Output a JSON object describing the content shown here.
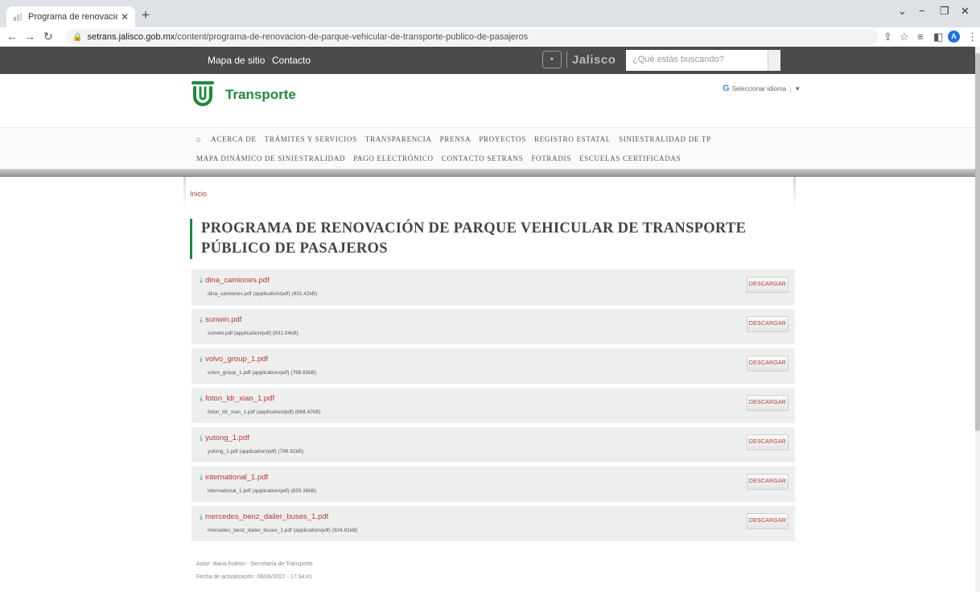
{
  "browser": {
    "tab_title": "Programa de renovación de parq",
    "tab_close": "✕",
    "new_tab": "+",
    "url_host": "setrans.jalisco.gob.mx",
    "url_path": "/content/programa-de-renovacion-de-parque-vehicular-de-transporte-publico-de-pasajeros",
    "profile_initial": "A",
    "nav_icons": [
      "back-icon",
      "forward-icon",
      "reload-icon"
    ]
  },
  "topbar": {
    "links": [
      "Mapa de sitio",
      "Contacto"
    ],
    "logo_text": "Jalisco",
    "search_placeholder": "¿Qué estás buscando?"
  },
  "brand": {
    "name": "Transporte",
    "color": "#1f8a3a",
    "translate_label": "Seleccionar idioma",
    "translate_arrow": "▼"
  },
  "nav": {
    "row1": [
      "ACERCA DE",
      "TRÁMITES Y SERVICIOS",
      "TRANSPARENCIA",
      "PRENSA",
      "PROYECTOS",
      "REGISTRO ESTATAL",
      "SINIESTRALIDAD DE TP"
    ],
    "row2": [
      "MAPA DINÁMICO DE SINIESTRALIDAD",
      "PAGO ELECTRÓNICO",
      "CONTACTO SETRANS",
      "FOTRADIS",
      "ESCUELAS CERTIFICADAS"
    ]
  },
  "breadcrumb": "Inicio",
  "page_title": "PROGRAMA DE RENOVACIÓN DE PARQUE VEHICULAR DE TRANSPORTE PÚBLICO DE PASAJEROS",
  "download_label": "DESCARGAR",
  "files": [
    {
      "name": "dina_camiones.pdf",
      "meta": "dina_camiones.pdf (application/pdf) (831.42kB)"
    },
    {
      "name": "sunwin.pdf",
      "meta": "sunwin.pdf (application/pdf) (831.04kB)"
    },
    {
      "name": "volvo_group_1.pdf",
      "meta": "volvo_group_1.pdf (application/pdf) (799.83kB)"
    },
    {
      "name": "foton_ldr_xian_1.pdf",
      "meta": "foton_ldr_xian_1.pdf (application/pdf) (868.47kB)"
    },
    {
      "name": "yutong_1.pdf",
      "meta": "yutong_1.pdf (application/pdf) (786.92kB)"
    },
    {
      "name": "international_1.pdf",
      "meta": "international_1.pdf (application/pdf) (839.36kB)"
    },
    {
      "name": "mercedes_benz_dailer_buses_1.pdf",
      "meta": "mercedes_benz_dailer_buses_1.pdf (application/pdf) (924.81kB)"
    }
  ],
  "footer": {
    "author": "Autor: diana.huitron - Secretaría de Transporte",
    "updated": "Fecha de actualización: 08/06/2022 - 17:34:41"
  }
}
